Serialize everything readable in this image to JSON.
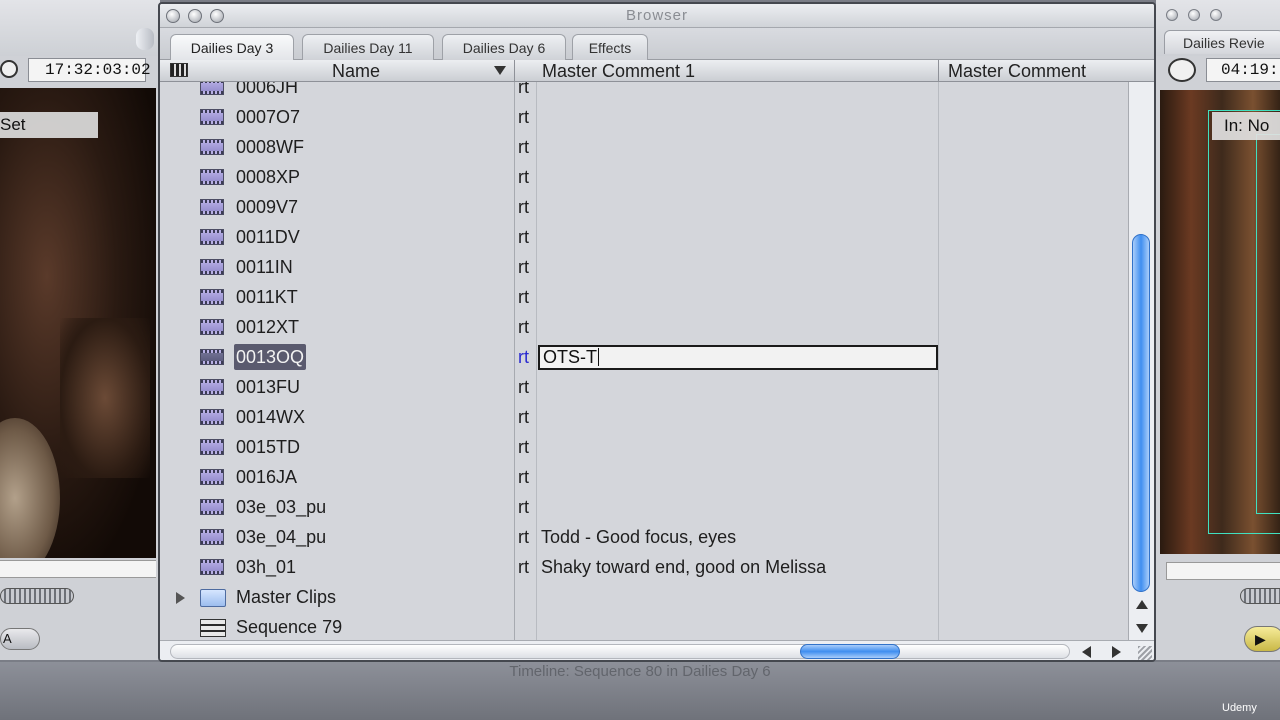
{
  "left_viewer": {
    "timecode": "17:32:03:02",
    "overlay_label": "Set",
    "mode_button": "A"
  },
  "right_viewer": {
    "tab": "Dailies Revie",
    "timecode": "04:19:",
    "overlay_label": "In: No"
  },
  "browser": {
    "title": "Browser",
    "tabs": [
      {
        "label": "Dailies Day 3",
        "active": true
      },
      {
        "label": "Dailies Day 11",
        "active": false
      },
      {
        "label": "Dailies Day 6",
        "active": false
      },
      {
        "label": "Effects",
        "active": false
      }
    ],
    "columns": {
      "name": "Name",
      "master_comment_1": "Master Comment 1",
      "master_comment_2": "Master Comment"
    },
    "rows": [
      {
        "name": "0006JH",
        "rt": "rt",
        "comment": ""
      },
      {
        "name": "0007O7",
        "rt": "rt",
        "comment": ""
      },
      {
        "name": "0008WF",
        "rt": "rt",
        "comment": ""
      },
      {
        "name": "0008XP",
        "rt": "rt",
        "comment": ""
      },
      {
        "name": "0009V7",
        "rt": "rt",
        "comment": ""
      },
      {
        "name": "0011DV",
        "rt": "rt",
        "comment": ""
      },
      {
        "name": "0011IN",
        "rt": "rt",
        "comment": ""
      },
      {
        "name": "0011KT",
        "rt": "rt",
        "comment": ""
      },
      {
        "name": "0012XT",
        "rt": "rt",
        "comment": ""
      },
      {
        "name": "0013OQ",
        "rt": "rt",
        "comment": "OTS-T",
        "selected": true,
        "editing": true
      },
      {
        "name": "0013FU",
        "rt": "rt",
        "comment": ""
      },
      {
        "name": "0014WX",
        "rt": "rt",
        "comment": ""
      },
      {
        "name": "0015TD",
        "rt": "rt",
        "comment": ""
      },
      {
        "name": "0016JA",
        "rt": "rt",
        "comment": ""
      },
      {
        "name": "03e_03_pu",
        "rt": "rt",
        "comment": ""
      },
      {
        "name": "03e_04_pu",
        "rt": "rt",
        "comment": "Todd - Good focus, eyes"
      },
      {
        "name": "03h_01",
        "rt": "rt",
        "comment": "Shaky toward end, good on Melissa"
      }
    ],
    "folder_row": {
      "name": "Master Clips"
    },
    "sequence_row": {
      "name": "Sequence 79"
    }
  },
  "timeline": {
    "title": "Timeline: Sequence 80 in Dailies Day 6"
  },
  "watermark": {
    "brand": "Udemy"
  },
  "colors": {
    "selection": "#5a5a6e",
    "scroll_accent": "#3f8ef0",
    "overlay_guide": "#40e0c0"
  }
}
